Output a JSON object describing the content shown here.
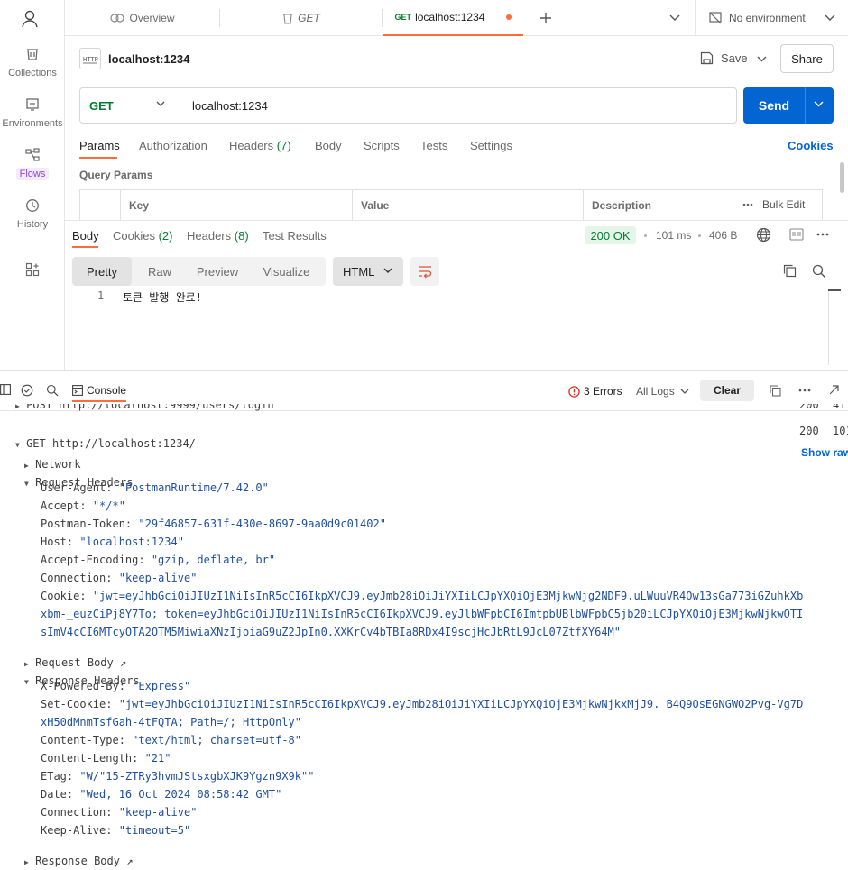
{
  "sidebar": {
    "items": [
      {
        "label": "Collections",
        "icon": "collections-icon"
      },
      {
        "label": "Environments",
        "icon": "environments-icon"
      },
      {
        "label": "Flows",
        "icon": "flows-icon"
      },
      {
        "label": "History",
        "icon": "history-icon"
      }
    ]
  },
  "tabs": {
    "overview": "Overview",
    "get_tab": "GET",
    "active_method": "GET",
    "active_title": "localhost:1234",
    "environment": "No environment"
  },
  "request": {
    "name": "localhost:1234",
    "save_label": "Save",
    "share_label": "Share",
    "method": "GET",
    "url": "localhost:1234",
    "send_label": "Send",
    "tabs": {
      "params": "Params",
      "authorization": "Authorization",
      "headers": "Headers",
      "headers_count": "(7)",
      "body": "Body",
      "scripts": "Scripts",
      "tests": "Tests",
      "settings": "Settings"
    },
    "cookies_link": "Cookies",
    "query_params_title": "Query Params",
    "table_headers": {
      "key": "Key",
      "value": "Value",
      "description": "Description",
      "bulk_edit": "Bulk Edit"
    }
  },
  "response": {
    "tabs": {
      "body": "Body",
      "cookies": "Cookies",
      "cookies_count": "(2)",
      "headers": "Headers",
      "headers_count": "(8)",
      "test_results": "Test Results"
    },
    "status": "200 OK",
    "time": "101 ms",
    "size": "406 B",
    "views": {
      "pretty": "Pretty",
      "raw": "Raw",
      "preview": "Preview",
      "visualize": "Visualize"
    },
    "format": "HTML",
    "lines": [
      {
        "num": "1",
        "text": "토큰 발행 완료!"
      }
    ]
  },
  "console": {
    "tab_label": "Console",
    "errors": "3 Errors",
    "filter": "All Logs",
    "clear_label": "Clear",
    "prev_entry": "POST http://localhost:9999/users/login",
    "prev_status": "200",
    "prev_time": "41",
    "entry": "GET http://localhost:1234/",
    "entry_status": "200",
    "entry_time": "101",
    "network": "Network",
    "show_raw": "Show raw",
    "request_headers_title": "Request Headers",
    "request_headers": [
      {
        "k": "User-Agent:",
        "v": "\"PostmanRuntime/7.42.0\""
      },
      {
        "k": "Accept:",
        "v": "\"*/*\""
      },
      {
        "k": "Postman-Token:",
        "v": "\"29f46857-631f-430e-8697-9aa0d9c01402\""
      },
      {
        "k": "Host:",
        "v": "\"localhost:1234\""
      },
      {
        "k": "Accept-Encoding:",
        "v": "\"gzip, deflate, br\""
      },
      {
        "k": "Connection:",
        "v": "\"keep-alive\""
      }
    ],
    "cookie_key": "Cookie:",
    "cookie_lines": [
      "\"jwt=eyJhbGciOiJIUzI1NiIsInR5cCI6IkpXVCJ9.eyJmb28iOiJiYXIiLCJpYXQiOjE3MjkwNjg2NDF9.uLWuuVR4Ow13sGa773iGZuhkXb",
      "xbm-_euzCiPj8Y7To; token=eyJhbGciOiJIUzI1NiIsInR5cCI6IkpXVCJ9.eyJlbWFpbCI6ImtpbUBlbWFpbC5jb20iLCJpYXQiOjE3MjkwNjkwOTI",
      "sImV4cCI6MTcyOTA2OTM5MiwiaXNzIjoiaG9uZ2JpIn0.XXKrCv4bTBIa8RDx4I9scjHcJbRtL9JcL07ZtfXY64M\""
    ],
    "request_body": "Request Body ↗",
    "response_headers_title": "Response Headers",
    "response_headers_before": [
      {
        "k": "X-Powered-By:",
        "v": "\"Express\""
      }
    ],
    "set_cookie_key": "Set-Cookie:",
    "set_cookie_lines": [
      "\"jwt=eyJhbGciOiJIUzI1NiIsInR5cCI6IkpXVCJ9.eyJmb28iOiJiYXIiLCJpYXQiOjE3MjkwNjkxMjJ9._B4Q9OsEGNGWO2Pvg-Vg7D",
      "xH50dMnmTsfGah-4tFQTA; Path=/; HttpOnly\""
    ],
    "response_headers_after": [
      {
        "k": "Content-Type:",
        "v": "\"text/html; charset=utf-8\""
      },
      {
        "k": "Content-Length:",
        "v": "\"21\""
      },
      {
        "k": "ETag:",
        "v": "\"W/\"15-ZTRy3hvmJStsxgbXJK9Ygzn9X9k\"\""
      },
      {
        "k": "Date:",
        "v": "\"Wed, 16 Oct 2024 08:58:42 GMT\""
      },
      {
        "k": "Connection:",
        "v": "\"keep-alive\""
      },
      {
        "k": "Keep-Alive:",
        "v": "\"timeout=5\""
      }
    ],
    "response_body": "Response Body ↗"
  },
  "colors": {
    "accent": "#ff6c37",
    "primary": "#0265d2",
    "success": "#007f31",
    "value": "#1f4f9c"
  }
}
